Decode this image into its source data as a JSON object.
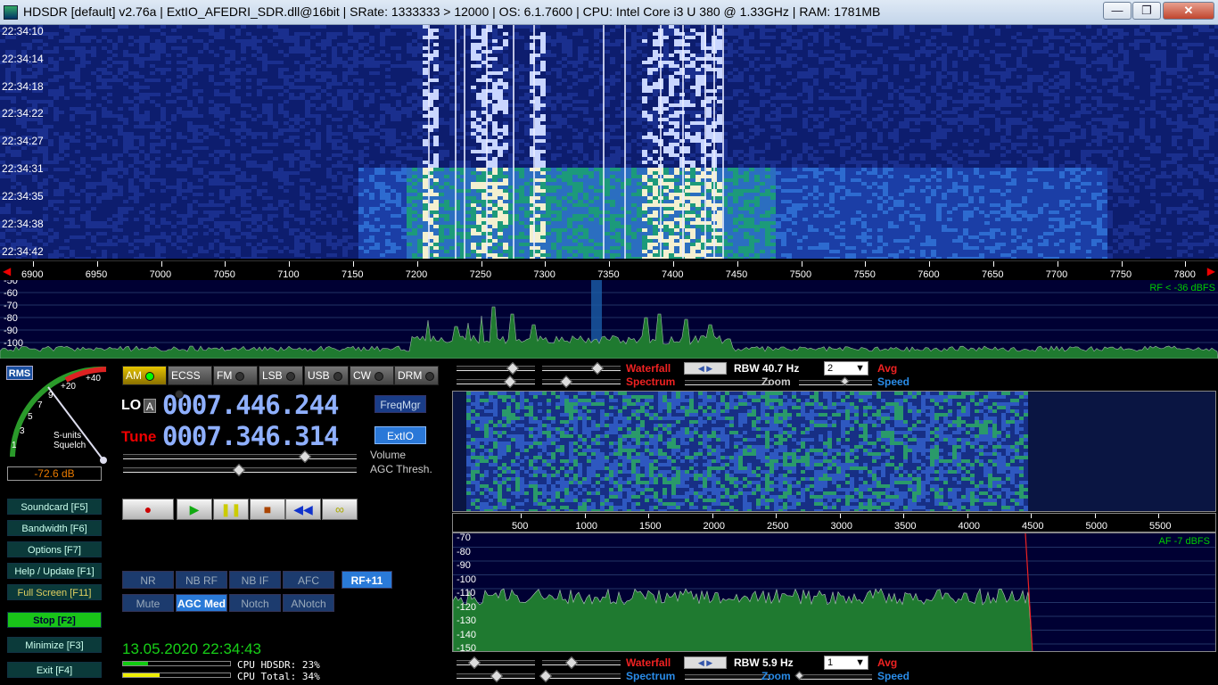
{
  "window": {
    "title": "HDSDR  [default]  v2.76a  |  ExtIO_AFEDRI_SDR.dll@16bit  |  SRate: 1333333 > 12000  |  OS: 6.1.7600   |  CPU: Intel Core i3       U 380  @ 1.33GHz  |  RAM: 1781MB",
    "min": "—",
    "max": "❐",
    "close": "✕"
  },
  "waterfall_top": {
    "times": [
      "22:34:10",
      "22:34:14",
      "22:34:18",
      "22:34:22",
      "22:34:27",
      "22:34:31",
      "22:34:35",
      "22:34:38",
      "22:34:42"
    ]
  },
  "freq_axis": [
    "6900",
    "6950",
    "7000",
    "7050",
    "7100",
    "7150",
    "7200",
    "7250",
    "7300",
    "7350",
    "7400",
    "7450",
    "7500",
    "7550",
    "7600",
    "7650",
    "7700",
    "7750",
    "7800"
  ],
  "spectrum_top": {
    "db_labels": [
      "-50",
      "-60",
      "-70",
      "-80",
      "-90",
      "-100"
    ],
    "rf_note": "RF < -36 dBFS"
  },
  "smeter": {
    "rms": "RMS",
    "scale": [
      "1",
      "3",
      "5",
      "7",
      "9",
      "+20",
      "+40"
    ],
    "label1": "S-units",
    "label2": "Squelch",
    "reading": "-72.6 dB"
  },
  "modes": [
    {
      "label": "AM",
      "on": true
    },
    {
      "label": "ECSS"
    },
    {
      "label": "FM"
    },
    {
      "label": "LSB"
    },
    {
      "label": "USB"
    },
    {
      "label": "CW"
    },
    {
      "label": "DRM"
    }
  ],
  "lo": {
    "label": "LO",
    "sub": "A",
    "freq": "0007.446.244"
  },
  "tune": {
    "label": "Tune",
    "freq": "0007.346.314"
  },
  "buttons": {
    "freqmgr": "FreqMgr",
    "extio": "ExtIO"
  },
  "sliders": {
    "volume": "Volume",
    "agc": "AGC Thresh."
  },
  "transport": {
    "record": "●",
    "play": "▶",
    "pause": "❚❚",
    "stop": "■",
    "rewind": "◀◀",
    "loop": "∞"
  },
  "side": [
    {
      "label": "Soundcard  [F5]"
    },
    {
      "label": "Bandwidth  [F6]"
    },
    {
      "label": "Options  [F7]"
    },
    {
      "label": "Help / Update  [F1]"
    },
    {
      "label": "Full Screen  [F11]"
    },
    {
      "label": "Stop      [F2]"
    },
    {
      "label": "Minimize  [F3]"
    },
    {
      "label": "Exit      [F4]"
    }
  ],
  "dsp": [
    {
      "label": "NR"
    },
    {
      "label": "NB RF"
    },
    {
      "label": "NB IF"
    },
    {
      "label": "AFC"
    },
    {
      "label": "RF+11",
      "on": true
    },
    {
      "label": "Mute"
    },
    {
      "label": "AGC Med",
      "on": true
    },
    {
      "label": "Notch"
    },
    {
      "label": "ANotch"
    }
  ],
  "status": {
    "datetime": "13.05.2020 22:34:43",
    "cpu_hdsdr": "CPU HDSDR: 23%",
    "cpu_total": "CPU Total: 34%",
    "cpu_hdsdr_frac": 0.23,
    "cpu_total_frac": 0.34
  },
  "rf_ctrl": {
    "waterfall": "Waterfall",
    "spectrum": "Spectrum",
    "zoom": "Zoom",
    "rbw": "RBW  40.7 Hz",
    "avg_val": "2",
    "avg": "Avg",
    "speed": "Speed"
  },
  "af_ctrl": {
    "waterfall": "Waterfall",
    "spectrum": "Spectrum",
    "zoom": "Zoom",
    "rbw": "RBW   5.9 Hz",
    "avg_val": "1",
    "avg": "Avg",
    "speed": "Speed"
  },
  "af_axis": [
    "500",
    "1000",
    "1500",
    "2000",
    "2500",
    "3000",
    "3500",
    "4000",
    "4500",
    "5000",
    "5500"
  ],
  "af_spec": {
    "db_labels": [
      "-70",
      "-80",
      "-90",
      "-100",
      "-110",
      "-120",
      "-130",
      "-140",
      "-150"
    ],
    "af_note": "AF  -7 dBFS"
  },
  "colors": {
    "waterfall_bg": "#0c1c6e",
    "spectrum_fill": "#1f7a30",
    "accent": "#2a78d8",
    "stop_green": "#19c419"
  }
}
